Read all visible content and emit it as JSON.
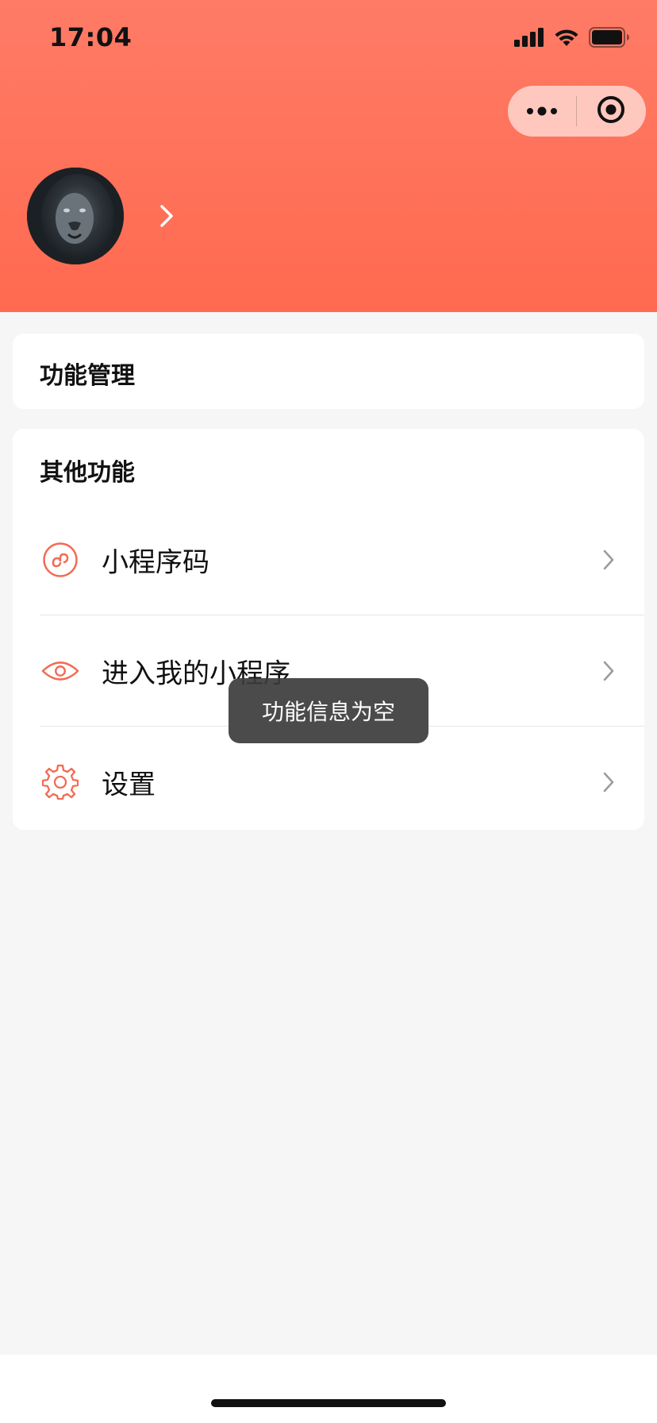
{
  "status_bar": {
    "time": "17:04",
    "icons": [
      "cellular-signal-icon",
      "wifi-icon",
      "battery-icon"
    ]
  },
  "capsule": {
    "more_icon": "more-dots-icon",
    "close_icon": "target-close-icon"
  },
  "profile": {
    "avatar": "avatar",
    "chevron_icon": "chevron-right-icon"
  },
  "sections": [
    {
      "title": "功能管理"
    },
    {
      "title": "其他功能",
      "items": [
        {
          "label": "小程序码",
          "icon": "mini-program-code-icon"
        },
        {
          "label": "进入我的小程序",
          "icon": "eye-icon"
        },
        {
          "label": "设置",
          "icon": "gear-icon"
        }
      ]
    }
  ],
  "toast": {
    "message": "功能信息为空"
  },
  "colors": {
    "header_top": "#ff7b66",
    "header_bottom": "#ff6a50",
    "accent": "#f26b55",
    "background": "#f6f6f6",
    "toast_bg": "#3c3c3c"
  }
}
